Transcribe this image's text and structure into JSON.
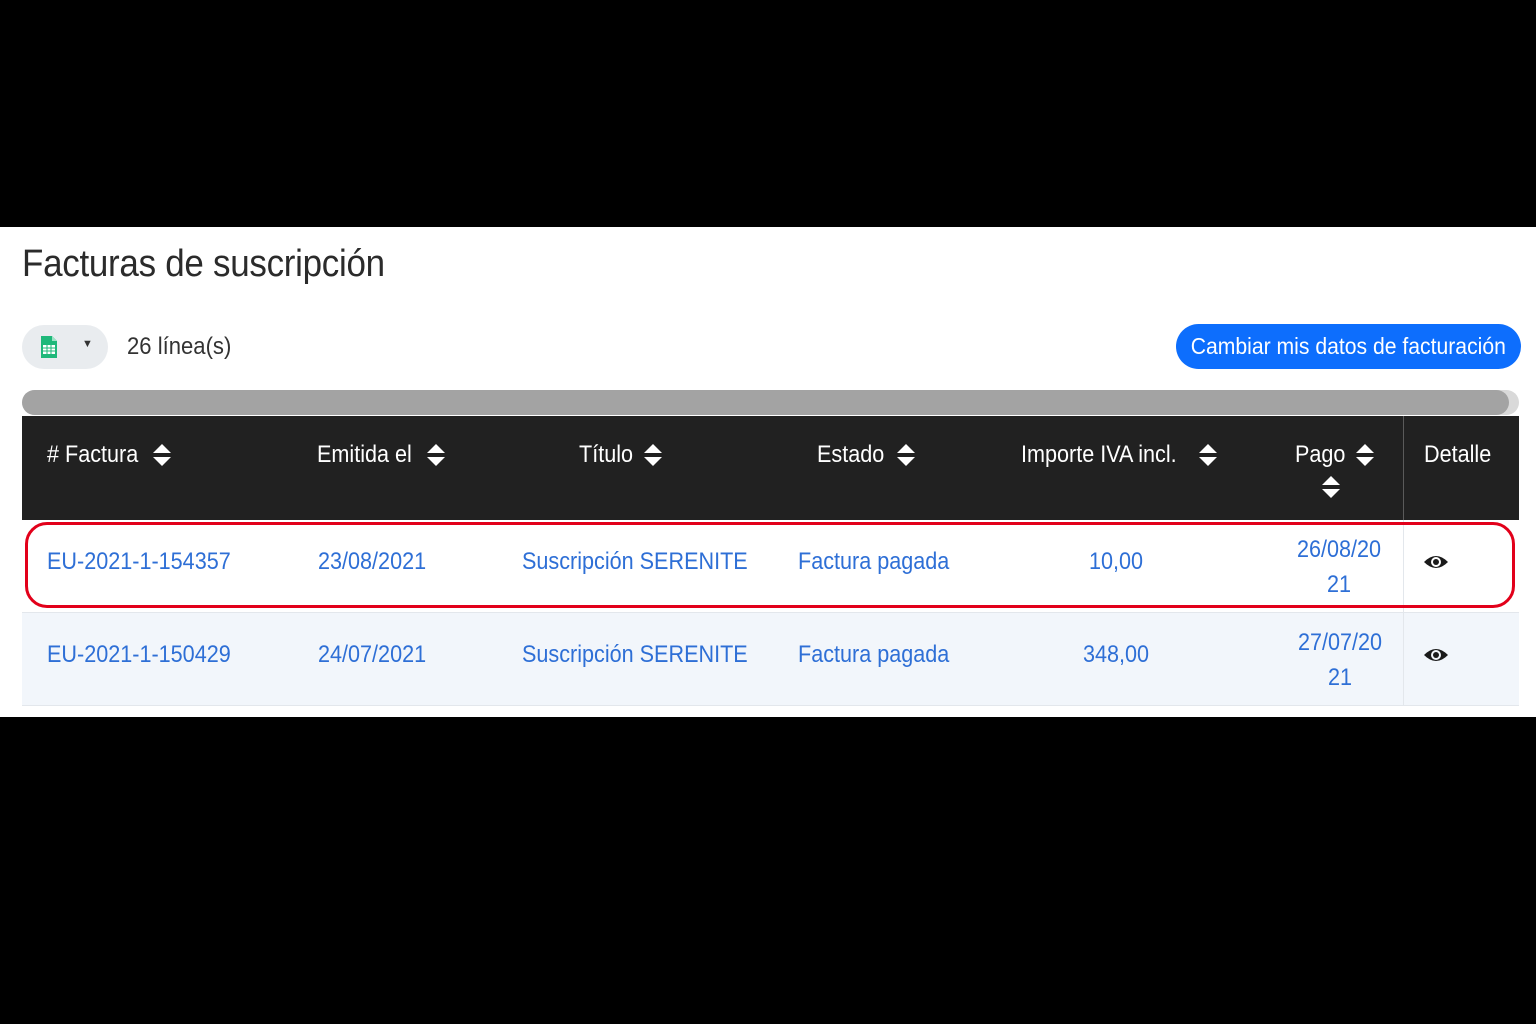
{
  "page": {
    "title": "Facturas de suscripción"
  },
  "toolbar": {
    "export_icon": "csv-file-icon",
    "row_count": "26 línea(s)",
    "billing_button": "Cambiar mis datos de facturación"
  },
  "colors": {
    "accent": "#0d6efd",
    "link": "#2e6fd6",
    "header_bg": "#212121",
    "highlight_border": "#e2001a",
    "export_icon": "#1fb87a"
  },
  "table": {
    "columns": [
      {
        "label": "# Factura",
        "sortable": true
      },
      {
        "label": "Emitida el",
        "sortable": true
      },
      {
        "label": "Título",
        "sortable": true
      },
      {
        "label": "Estado",
        "sortable": true
      },
      {
        "label": "Importe IVA incl.",
        "sortable": true
      },
      {
        "label": "Pago",
        "sortable": true
      },
      {
        "label": "Detalle",
        "sortable": false
      }
    ],
    "rows": [
      {
        "factura": "EU-2021-1-154357",
        "emitida": "23/08/2021",
        "titulo": "Suscripción SERENITE",
        "estado": "Factura pagada",
        "importe": "10,00",
        "pago": "26/08/2021",
        "detalle_icon": "eye-icon",
        "highlighted": true
      },
      {
        "factura": "EU-2021-1-150429",
        "emitida": "24/07/2021",
        "titulo": "Suscripción SERENITE",
        "estado": "Factura pagada",
        "importe": "348,00",
        "pago": "27/07/2021",
        "detalle_icon": "eye-icon",
        "highlighted": false
      }
    ]
  }
}
